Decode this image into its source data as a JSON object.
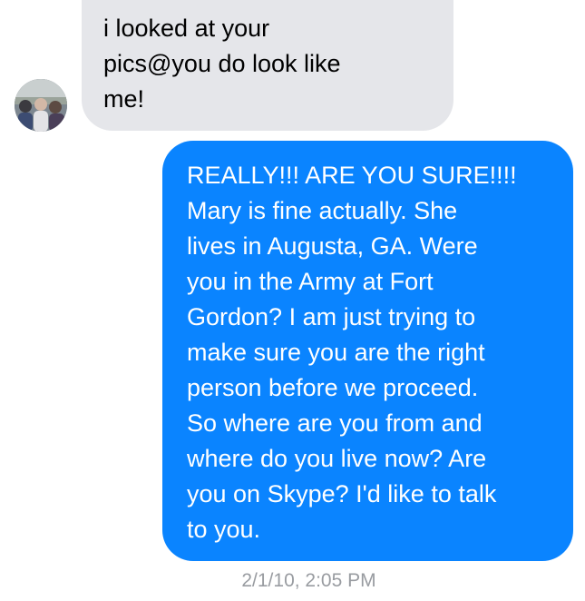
{
  "conversation": {
    "messages": [
      {
        "direction": "incoming",
        "text": "i looked at your\npics@you do look like\nme!"
      },
      {
        "direction": "outgoing",
        "text": "REALLY!!! ARE YOU SURE!!!!\nMary is fine actually. She\nlives in Augusta, GA. Were\nyou in the Army at Fort\nGordon? I am just trying to\nmake sure you are the right\nperson before we proceed.\nSo where are you from and\nwhere do you live now? Are\nyou on Skype? I'd like to talk\nto you."
      }
    ],
    "timestamp": "2/1/10, 2:05 PM"
  },
  "colors": {
    "incoming_bubble": "#e5e6ea",
    "outgoing_bubble": "#0a84ff",
    "timestamp_text": "#999ca1"
  },
  "icons": {
    "avatar": "contact-avatar"
  }
}
